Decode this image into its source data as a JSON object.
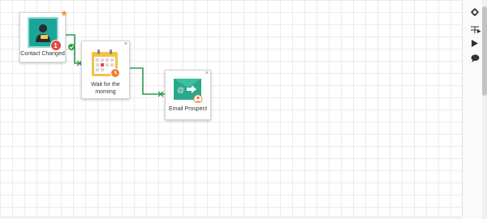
{
  "nodes": {
    "contact_changed": {
      "label": "Contact Changed",
      "badge_count": "1"
    },
    "wait": {
      "label_line1": "Wait for the",
      "label_line2": "morning"
    },
    "email": {
      "label": "Email Prospect",
      "at_symbol": "@"
    }
  },
  "colors": {
    "connector": "#2e9b4c",
    "teal": "#1aa59a",
    "email_green": "#2aa88a",
    "calendar_yellow": "#f6c243",
    "orange": "#ee7f3a",
    "badge_red": "#e2493d"
  },
  "toolbar": {
    "icons": [
      "gear-icon",
      "filter-icon",
      "play-icon",
      "comment-icon"
    ]
  }
}
